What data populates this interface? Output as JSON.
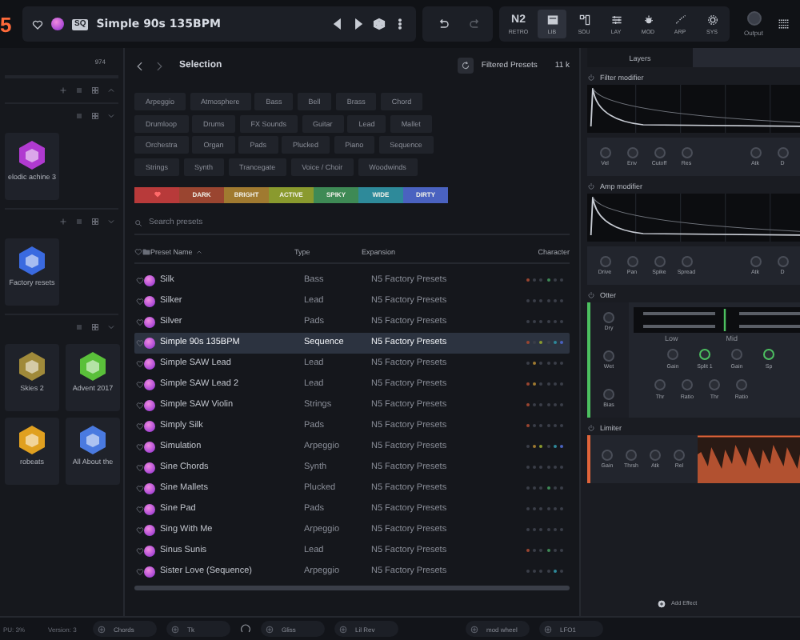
{
  "top_bar": {
    "logo": "5",
    "preset": {
      "favorite": false,
      "badge": "SQ",
      "name": "Simple 90s 135BPM"
    },
    "retro": {
      "logo": "N2",
      "label": "RETRO"
    },
    "tabs": [
      {
        "kind": "library",
        "label": "LIB",
        "selected": true
      },
      {
        "kind": "sound",
        "label": "SOU",
        "selected": false
      },
      {
        "kind": "layers",
        "label": "LAY",
        "selected": false
      },
      {
        "kind": "mod",
        "label": "MOD",
        "selected": false
      },
      {
        "kind": "arp",
        "label": "ARP",
        "selected": false
      },
      {
        "kind": "gear",
        "label": "SYS",
        "selected": false
      }
    ],
    "output": "Output"
  },
  "sidebar": {
    "count": "974",
    "sections": [
      {
        "expanded": false,
        "plus": true
      },
      {
        "expanded": true,
        "plus": false,
        "tiles": [
          {
            "label": "elodic achine 3",
            "color": "#b03ad0"
          }
        ]
      },
      {
        "expanded": true,
        "plus": true,
        "tiles": [
          {
            "label": "Factory resets",
            "color": "#3a6ae0"
          }
        ]
      },
      {
        "expanded": true,
        "plus": false,
        "tiles": [
          {
            "label": "Skies 2",
            "color": "#a08a3a"
          },
          {
            "label": "Advent 2017",
            "color": "#5ac03a"
          },
          {
            "label": "robeats",
            "color": "#e0a020"
          },
          {
            "label": "All About the",
            "color": "#4a7ae0"
          }
        ]
      }
    ]
  },
  "browser": {
    "title": "Selection",
    "filtered_label": "Filtered Presets",
    "filtered_count": "11 k",
    "tag_rows": [
      [
        "Arpeggio",
        "Atmosphere",
        "Bass",
        "Bell",
        "Brass",
        "Chord"
      ],
      [
        "Drumloop",
        "Drums",
        "FX Sounds",
        "Guitar",
        "Lead",
        "Mallet"
      ],
      [
        "Orchestra",
        "Organ",
        "Pads",
        "Plucked",
        "Piano",
        "Sequence"
      ],
      [
        "Strings",
        "Synth",
        "Trancegate",
        "Voice / Choir",
        "Woodwinds"
      ]
    ],
    "character_tags": [
      {
        "kind": "favorite",
        "color": "#b83a3a"
      },
      {
        "kind": "label",
        "label": "DARK",
        "color": "#9a4530"
      },
      {
        "kind": "label",
        "label": "BRIGHT",
        "color": "#a07a30"
      },
      {
        "kind": "label",
        "label": "ACTIVE",
        "color": "#8a9a2e"
      },
      {
        "kind": "label",
        "label": "SPIKY",
        "color": "#3e8a55"
      },
      {
        "kind": "label",
        "label": "WIDE",
        "color": "#2e8a9a"
      },
      {
        "kind": "label",
        "label": "DIRTY",
        "color": "#4a62c0"
      }
    ],
    "search": {
      "placeholder": "Search presets"
    },
    "columns": [
      "Preset Name",
      "Type",
      "Expansion",
      "Character"
    ],
    "rows": [
      {
        "name": "Silk",
        "type": "Bass",
        "expansion": "N5 Factory Presets",
        "selected": false,
        "character": [
          true,
          false,
          false,
          true,
          false,
          false
        ]
      },
      {
        "name": "Silker",
        "type": "Lead",
        "expansion": "N5 Factory Presets",
        "selected": false,
        "character": [
          false,
          false,
          false,
          false,
          false,
          false
        ]
      },
      {
        "name": "Silver",
        "type": "Pads",
        "expansion": "N5 Factory Presets",
        "selected": false,
        "character": [
          false,
          false,
          false,
          false,
          false,
          false
        ]
      },
      {
        "name": "Simple 90s 135BPM",
        "type": "Sequence",
        "expansion": "N5 Factory Presets",
        "selected": true,
        "character": [
          true,
          false,
          true,
          false,
          true,
          true
        ]
      },
      {
        "name": "Simple SAW Lead",
        "type": "Lead",
        "expansion": "N5 Factory Presets",
        "selected": false,
        "character": [
          false,
          true,
          false,
          false,
          false,
          false
        ]
      },
      {
        "name": "Simple SAW Lead 2",
        "type": "Lead",
        "expansion": "N5 Factory Presets",
        "selected": false,
        "character": [
          true,
          true,
          false,
          false,
          false,
          false
        ]
      },
      {
        "name": "Simple SAW Violin",
        "type": "Strings",
        "expansion": "N5 Factory Presets",
        "selected": false,
        "character": [
          true,
          false,
          false,
          false,
          false,
          false
        ]
      },
      {
        "name": "Simply Silk",
        "type": "Pads",
        "expansion": "N5 Factory Presets",
        "selected": false,
        "character": [
          true,
          false,
          false,
          false,
          false,
          false
        ]
      },
      {
        "name": "Simulation",
        "type": "Arpeggio",
        "expansion": "N5 Factory Presets",
        "selected": false,
        "character": [
          false,
          true,
          true,
          false,
          true,
          true
        ]
      },
      {
        "name": "Sine Chords",
        "type": "Synth",
        "expansion": "N5 Factory Presets",
        "selected": false,
        "character": [
          false,
          false,
          false,
          false,
          false,
          false
        ]
      },
      {
        "name": "Sine Mallets",
        "type": "Plucked",
        "expansion": "N5 Factory Presets",
        "selected": false,
        "character": [
          false,
          false,
          false,
          true,
          false,
          false
        ]
      },
      {
        "name": "Sine Pad",
        "type": "Pads",
        "expansion": "N5 Factory Presets",
        "selected": false,
        "character": [
          false,
          false,
          false,
          false,
          false,
          false
        ]
      },
      {
        "name": "Sing With Me",
        "type": "Arpeggio",
        "expansion": "N5 Factory Presets",
        "selected": false,
        "character": [
          false,
          false,
          false,
          false,
          false,
          false
        ]
      },
      {
        "name": "Sinus Sunis",
        "type": "Lead",
        "expansion": "N5 Factory Presets",
        "selected": false,
        "character": [
          true,
          false,
          false,
          true,
          false,
          false
        ]
      },
      {
        "name": "Sister Love (Sequence)",
        "type": "Arpeggio",
        "expansion": "N5 Factory Presets",
        "selected": false,
        "character": [
          false,
          false,
          false,
          false,
          true,
          false
        ]
      }
    ]
  },
  "layers_panel": {
    "tab": "Layers",
    "modules": [
      {
        "kind": "envelope",
        "title": "Filter modifier",
        "knobs": [
          "Vel",
          "Env",
          "Cutoff",
          "Res"
        ],
        "knobs_right": [
          "Atk",
          "D"
        ]
      },
      {
        "kind": "envelope",
        "title": "Amp modifier",
        "knobs": [
          "Drive",
          "Pan",
          "Spike",
          "Spread"
        ],
        "knobs_right": [
          "Atk",
          "D"
        ]
      },
      {
        "kind": "splitter",
        "title": "Otter",
        "color": "#4cc060",
        "side_knobs": [
          "Dry",
          "Wet",
          "Bias"
        ],
        "bands": [
          "Low",
          "Mid"
        ],
        "knobs_top": [
          "Gain",
          "Split 1",
          "Gain",
          "Sp"
        ],
        "knobs_bottom": [
          "Thr",
          "Ratio",
          "Thr",
          "Ratio"
        ]
      },
      {
        "kind": "limiter",
        "title": "Limiter",
        "color": "#e0643a",
        "knobs": [
          "Gain",
          "Thrsh",
          "Atk",
          "Rel"
        ]
      }
    ],
    "add_label": "Add Effect"
  },
  "status_bar": {
    "texts": [
      "PU: 3%",
      "Version: 3"
    ],
    "macros": [
      "Chords",
      "Tk",
      "Gliss",
      "Lil Rev",
      "mod wheel",
      "LFO1"
    ]
  }
}
